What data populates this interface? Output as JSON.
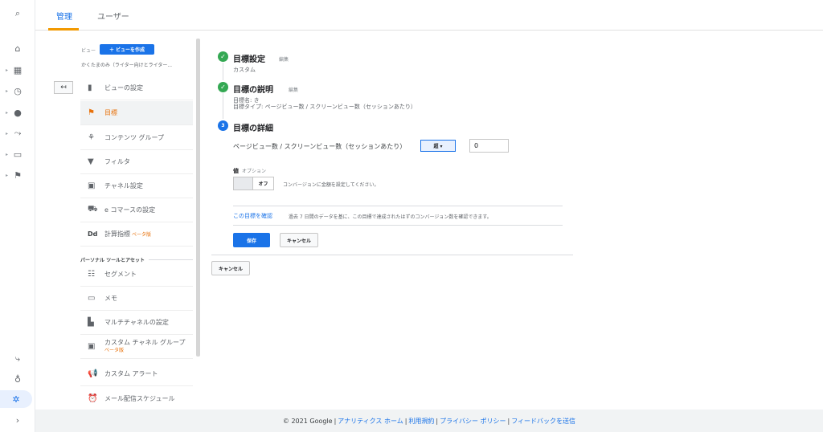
{
  "rail": {
    "items": [
      {
        "icon": "search-icon",
        "glyph": "⌕"
      },
      {
        "icon": "home-icon",
        "glyph": "⌂"
      },
      {
        "icon": "dashboard-icon",
        "glyph": "▦"
      },
      {
        "icon": "clock-icon",
        "glyph": "◷"
      },
      {
        "icon": "person-icon",
        "glyph": "●"
      },
      {
        "icon": "acquisition-icon",
        "glyph": "⤳"
      },
      {
        "icon": "behavior-icon",
        "glyph": "▭"
      },
      {
        "icon": "flag-icon",
        "glyph": "⚑"
      },
      {
        "icon": "attribution-icon",
        "glyph": "⤷"
      },
      {
        "icon": "lightbulb-icon",
        "glyph": "♁"
      },
      {
        "icon": "gear-icon",
        "glyph": "✲"
      },
      {
        "icon": "expand-icon",
        "glyph": "›"
      }
    ]
  },
  "tabs": {
    "admin": "管理",
    "users": "ユーザー"
  },
  "view_column": {
    "view_label": "ビュー",
    "create_view": "＋ ビューを作成",
    "view_name": "かくたまのみ（ライター向けとライター..."
  },
  "menu": {
    "view_settings": "ビューの設定",
    "goals": "目標",
    "content_grouping": "コンテンツ グループ",
    "filters": "フィルタ",
    "channel_settings": "チャネル設定",
    "ecommerce": "e コマースの設定",
    "calculated_metrics": "計算指標",
    "beta": "ベータ版",
    "personal_tools_head": "パーソナル ツールとアセット",
    "segments": "セグメント",
    "notes": "メモ",
    "multichannel": "マルチチャネルの設定",
    "custom_channel_grouping": "カスタム チャネル グループ",
    "custom_alerts": "カスタム アラート",
    "scheduled_emails": "メール配信スケジュール",
    "calc_icon": "Dd"
  },
  "goal": {
    "setup_title": "目標設定",
    "setup_edit": "編集",
    "setup_value": "カスタム",
    "desc_title": "目標の説明",
    "desc_edit": "編集",
    "desc_name": "目標名: き",
    "desc_type": "目標タイプ: ページビュー数 / スクリーンビュー数（セッションあたり）",
    "details_step": "3",
    "details_title": "目標の詳細",
    "condition_label": "ページビュー数 / スクリーンビュー数（セッションあたり）",
    "operator": "超 ▾",
    "value": "0",
    "value_head": "値",
    "value_optional": "オプション",
    "toggle_off": "オフ",
    "toggle_hint": "コンバージョンに金額を設定してください。",
    "verify_link": "この目標を確認",
    "verify_hint": "過去 7 日間のデータを基に、この目標で達成されたはずのコンバージョン数を確認できます。",
    "save": "保存",
    "cancel": "キャンセル",
    "cancel_outer": "キャンセル"
  },
  "footer": {
    "copyright": "© 2021 Google",
    "analytics_home": "アナリティクス ホーム",
    "terms": "利用規約",
    "privacy": "プライバシー ポリシー",
    "feedback": "フィードバックを送信",
    "separator": "|"
  }
}
